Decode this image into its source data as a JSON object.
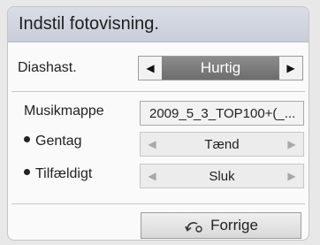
{
  "dialog": {
    "title": "Indstil fotovisning."
  },
  "slide_speed": {
    "label": "Diashast.",
    "value": "Hurtig",
    "left_arrow": "◀",
    "right_arrow": "▶"
  },
  "music_folder": {
    "label": "Musikmappe",
    "value": "2009_5_3_TOP100+(_..."
  },
  "repeat": {
    "label": "Gentag",
    "value": "Tænd",
    "left_arrow": "◀",
    "right_arrow": "▶"
  },
  "shuffle": {
    "label": "Tilfældigt",
    "value": "Sluk",
    "left_arrow": "◀",
    "right_arrow": "▶"
  },
  "footer": {
    "back_label": "Forrige",
    "back_icon": "back-arrow-icon"
  }
}
